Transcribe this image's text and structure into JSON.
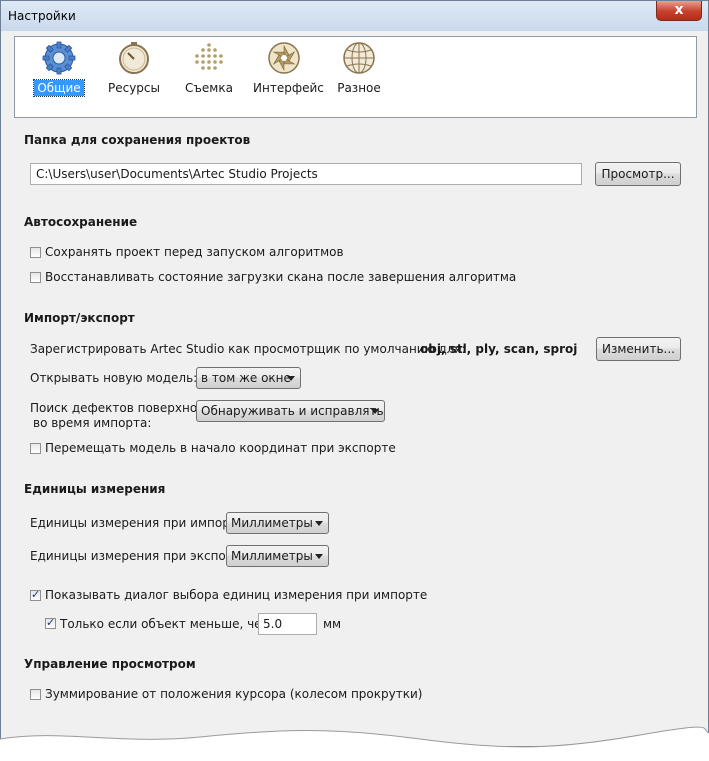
{
  "window": {
    "title": "Настройки",
    "close_label": "x"
  },
  "tabs": [
    {
      "label": "Общие",
      "icon": "gear-icon",
      "active": true
    },
    {
      "label": "Ресурсы",
      "icon": "gauge-icon",
      "active": false
    },
    {
      "label": "Съемка",
      "icon": "dots-grid-icon",
      "active": false
    },
    {
      "label": "Интерфейс",
      "icon": "aperture-icon",
      "active": false
    },
    {
      "label": "Разное",
      "icon": "globe-icon",
      "active": false
    }
  ],
  "project_folder": {
    "heading": "Папка для сохранения проектов",
    "path": "C:\\Users\\user\\Documents\\Artec Studio Projects",
    "browse_label": "Просмотр..."
  },
  "autosave": {
    "heading": "Автосохранение",
    "save_before_algorithms": {
      "label": "Сохранять проект перед запуском алгоритмов",
      "checked": false
    },
    "restore_scan_state": {
      "label": "Восстанавливать состояние загрузки скана после завершения алгоритма",
      "checked": false
    }
  },
  "import_export": {
    "heading": "Импорт/экспорт",
    "register_label": "Зарегистрировать Artec Studio как просмотрщик по умолчанию для:",
    "register_formats": "obj, stl, ply, scan, sproj",
    "change_label": "Изменить...",
    "open_model_label": "Открывать новую модель:",
    "open_model_value": "в том же окне",
    "defects_label_1": "Поиск дефектов поверхности",
    "defects_label_2": "во время импорта:",
    "defects_value": "Обнаруживать и исправлять",
    "move_to_origin": {
      "label": "Перемещать модель в начало координат при экспорте",
      "checked": false
    }
  },
  "units": {
    "heading": "Единицы измерения",
    "import_label": "Единицы измерения при импорте:",
    "import_value": "Миллиметры",
    "export_label": "Единицы измерения при экспорте:",
    "export_value": "Миллиметры",
    "show_dialog": {
      "label": "Показывать диалог выбора единиц измерения при импорте",
      "checked": true
    },
    "only_if_smaller": {
      "label": "Только если объект меньше, чем",
      "checked": true
    },
    "threshold_value": "5.0",
    "threshold_unit": "мм"
  },
  "view_control": {
    "heading": "Управление просмотром",
    "zoom_from_cursor": {
      "label": "Зуммирование от положения курсора (колесом прокрутки)",
      "checked": false
    }
  },
  "colors": {
    "accent": "#3399ff",
    "close_button": "#c6402c",
    "titlebar": "#c9d9ec"
  }
}
